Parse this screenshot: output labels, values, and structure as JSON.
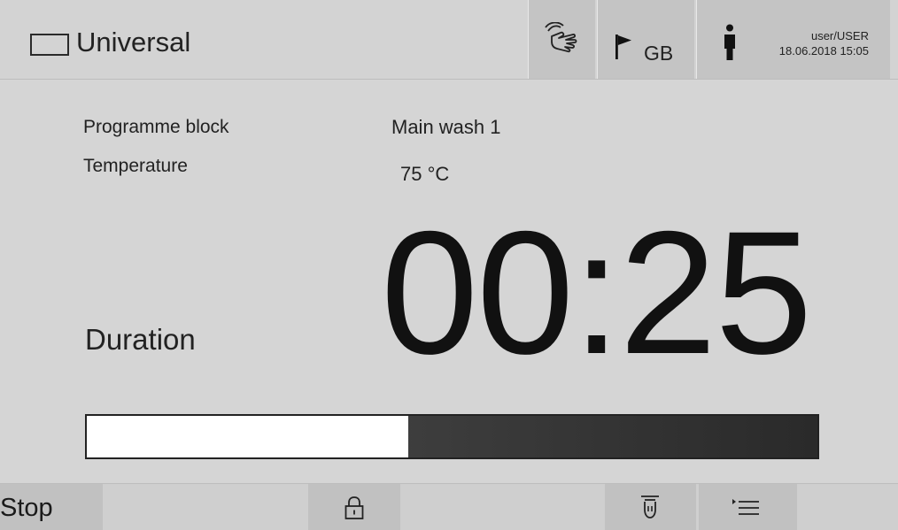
{
  "header": {
    "title": "Universal",
    "language": "GB",
    "user": "user/USER",
    "datetime": "18.06.2018 15:05"
  },
  "info": {
    "programme_block_label": "Programme block",
    "programme_block_value": "Main wash 1",
    "temperature_label": "Temperature",
    "temperature_value": "75 °C"
  },
  "duration": {
    "label": "Duration",
    "time": "00:25"
  },
  "progress": {
    "fraction": 0.44
  },
  "footer": {
    "stop_label": "Stop"
  },
  "icons": {
    "title": "rectangle-icon",
    "touch": "hand-touch-icon",
    "language": "flag-icon",
    "user": "person-icon",
    "lock": "padlock-icon",
    "spray": "spray-arm-icon",
    "menu": "list-menu-icon"
  }
}
